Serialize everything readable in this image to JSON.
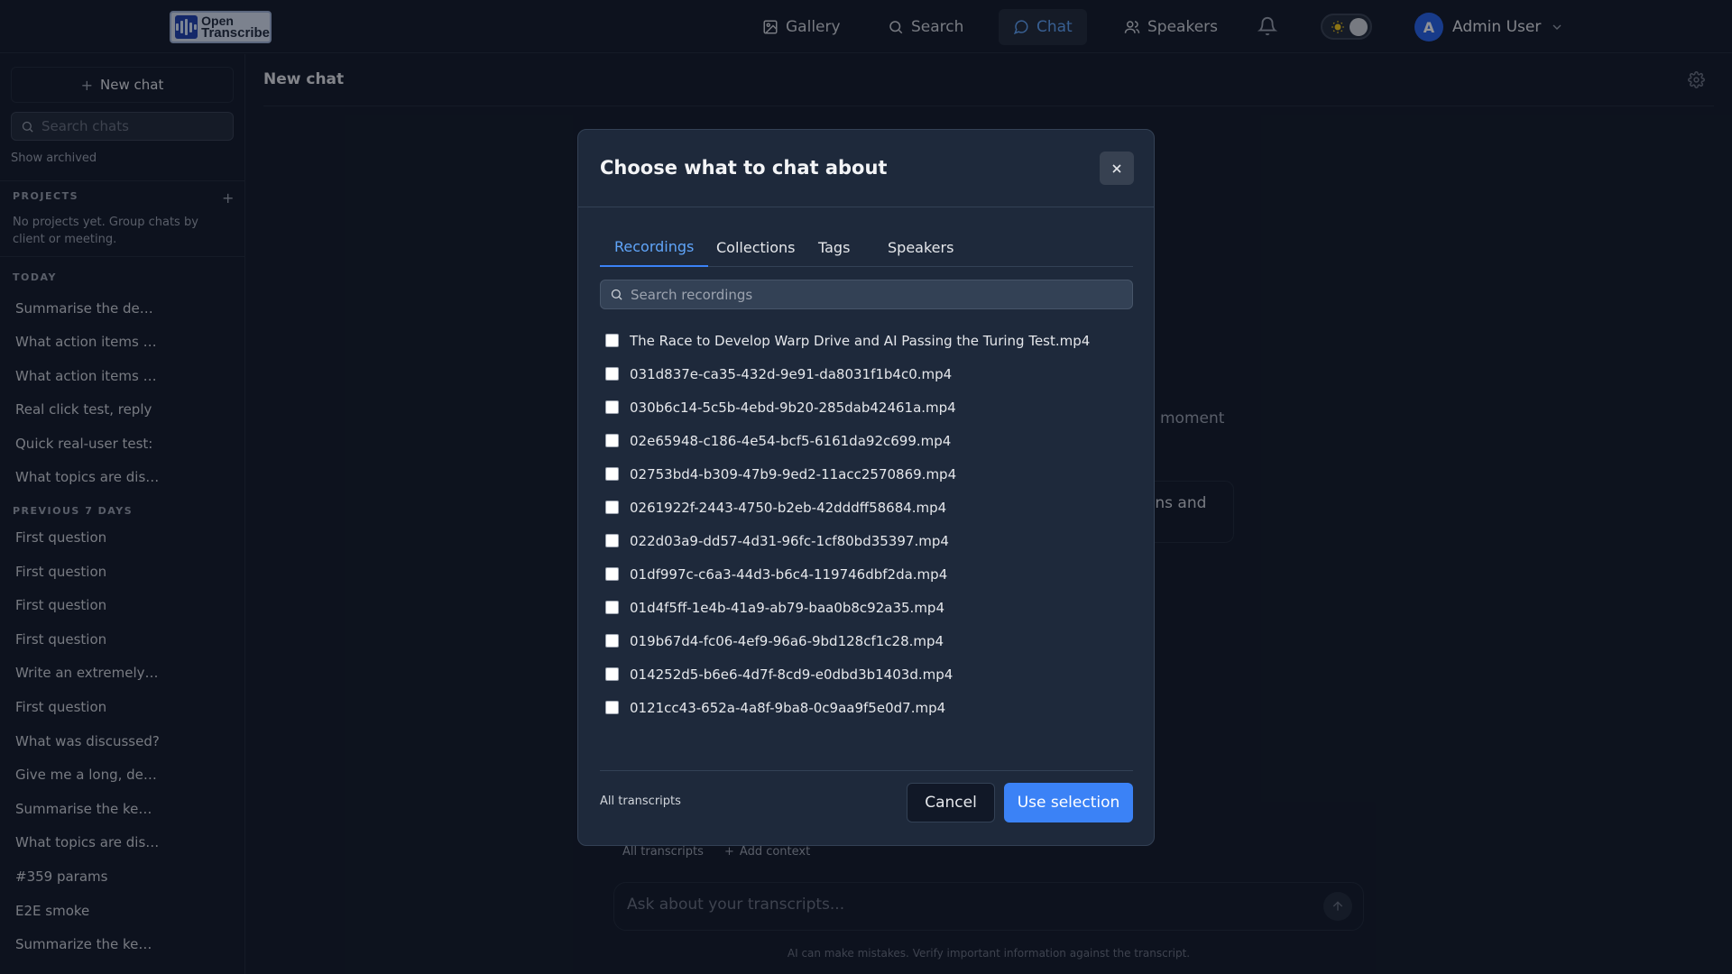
{
  "brand": {
    "line1": "Open",
    "line2": "Transcribe"
  },
  "nav": {
    "items": [
      {
        "label": "Gallery",
        "icon": "image-icon"
      },
      {
        "label": "Search",
        "icon": "search-icon"
      },
      {
        "label": "Chat",
        "icon": "chat-icon"
      },
      {
        "label": "Speakers",
        "icon": "users-icon"
      }
    ],
    "active": "Chat",
    "user": {
      "initial": "A",
      "name": "Admin User"
    }
  },
  "sidebar": {
    "new_chat": "New chat",
    "search_placeholder": "Search chats",
    "show_archived": "Show archived",
    "projects_label": "PROJECTS",
    "projects_add": "+",
    "projects_empty": "No projects yet. Group chats by client or meeting.",
    "today_label": "TODAY",
    "today": [
      "Summarise the decisions",
      "What action items came",
      "What action items came",
      "Real click test, reply",
      "Quick real-user test:",
      "What topics are discussed"
    ],
    "prev_label": "PREVIOUS 7 DAYS",
    "previous": [
      "First question",
      "First question",
      "First question",
      "First question",
      "Write an extremely long",
      "First question",
      "What was discussed?",
      "Give me a long, detailed",
      "Summarise the key points",
      "What topics are discussed",
      "#359 params",
      "E2E smoke",
      "Summarize the key decisions"
    ]
  },
  "main": {
    "title": "New chat",
    "behind_text1": "moment",
    "behind_text2": "ons and",
    "context_all": "All transcripts",
    "context_add": "Add context",
    "composer_placeholder": "Ask about your transcripts...",
    "disclaimer": "AI can make mistakes. Verify important information against the transcript."
  },
  "modal": {
    "title": "Choose what to chat about",
    "tabs": [
      "Recordings",
      "Collections",
      "Tags",
      "Speakers"
    ],
    "active_tab": "Recordings",
    "search_placeholder": "Search recordings",
    "recordings": [
      "The Race to Develop Warp Drive and AI Passing the Turing Test.mp4",
      "031d837e-ca35-432d-9e91-da8031f1b4c0.mp4",
      "030b6c14-5c5b-4ebd-9b20-285dab42461a.mp4",
      "02e65948-c186-4e54-bcf5-6161da92c699.mp4",
      "02753bd4-b309-47b9-9ed2-11acc2570869.mp4",
      "0261922f-2443-4750-b2eb-42dddff58684.mp4",
      "022d03a9-dd57-4d31-96fc-1cf80bd35397.mp4",
      "01df997c-c6a3-44d3-b6c4-119746dbf2da.mp4",
      "01d4f5ff-1e4b-41a9-ab79-baa0b8c92a35.mp4",
      "019b67d4-fc06-4ef9-96a6-9bd128cf1c28.mp4",
      "014252d5-b6e6-4d7f-8cd9-e0dbd3b1403d.mp4",
      "0121cc43-652a-4a8f-9ba8-0c9aa9f5e0d7.mp4"
    ],
    "footer_label": "All transcripts",
    "cancel": "Cancel",
    "use_selection": "Use selection"
  },
  "colors": {
    "accent": "#3b82f6",
    "background": "#111827",
    "modal": "#1e293b"
  }
}
